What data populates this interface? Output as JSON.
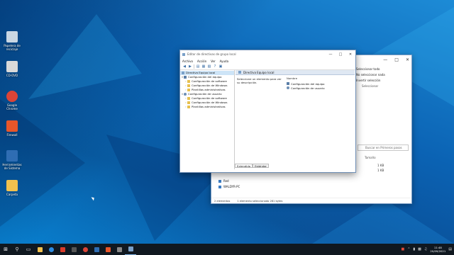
{
  "desktop": {
    "icons": [
      {
        "name": "recycle-bin",
        "label": "Papelera de reciclaje",
        "color": "#c9d6e3"
      },
      {
        "name": "drive",
        "label": "CD-DVD",
        "color": "#d9d9d9"
      },
      {
        "name": "chrome",
        "label": "Google Chrome",
        "color": "#db4437"
      },
      {
        "name": "app",
        "label": "Firewall",
        "color": "#e8562a"
      },
      {
        "name": "app2",
        "label": "Herramientas de Sistema",
        "color": "#2f6db3"
      },
      {
        "name": "folder",
        "label": "Carpeta",
        "color": "#f2c14e"
      }
    ]
  },
  "explorer": {
    "ribbon": [
      "Seleccionar todo",
      "No seleccionar nada",
      "Invertir selección",
      "Seleccionar"
    ],
    "search_placeholder": "Buscar en Primeros pasos",
    "column_size": "Tamaño",
    "sizes": [
      "1 KB",
      "1 KB"
    ],
    "bottom_items": [
      "Red",
      "WALDYR-PC"
    ],
    "status": [
      "2 elementos",
      "1 elemento seleccionado 281 bytes"
    ]
  },
  "gpedit": {
    "title": "Editor de directivas de grupo local",
    "menu": [
      "Archivo",
      "Acción",
      "Ver",
      "Ayuda"
    ],
    "tree": [
      {
        "label": "Directiva Equipo local",
        "level": 0,
        "icon": "policy",
        "selected": true
      },
      {
        "label": "Configuración del equipo",
        "level": 1,
        "icon": "pc"
      },
      {
        "label": "Configuración de software",
        "level": 2,
        "icon": "folder"
      },
      {
        "label": "Configuración de Windows",
        "level": 2,
        "icon": "folder"
      },
      {
        "label": "Plantillas administrativas",
        "level": 2,
        "icon": "folder"
      },
      {
        "label": "Configuración de usuario",
        "level": 1,
        "icon": "user"
      },
      {
        "label": "Configuración de software",
        "level": 2,
        "icon": "folder"
      },
      {
        "label": "Configuración de Windows",
        "level": 2,
        "icon": "folder"
      },
      {
        "label": "Plantillas administrativas",
        "level": 2,
        "icon": "folder"
      }
    ],
    "header": "Directiva Equipo local",
    "description": "Seleccione un elemento para ver su descripción.",
    "list_header": "Nombre",
    "list": [
      "Configuración del equipo",
      "Configuración de usuario"
    ],
    "tabs": [
      "Extendido",
      "Estándar"
    ]
  },
  "taskbar": {
    "time": "11:48",
    "date": "20/09/2021"
  }
}
